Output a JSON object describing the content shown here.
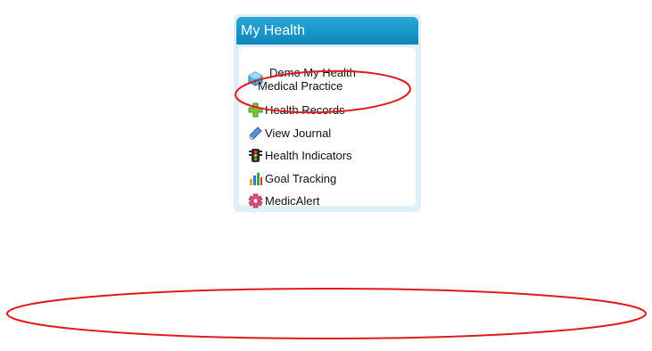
{
  "widget": {
    "title": "My Health",
    "items": [
      {
        "label_line1": "Demo My Health",
        "label_line2": "Medical Practice",
        "icon": "practice-icon"
      },
      {
        "label": "Health Records",
        "icon": "plus-cross-icon"
      },
      {
        "label": "View Journal",
        "icon": "pencil-icon"
      },
      {
        "label": "Health Indicators",
        "icon": "traffic-light-icon"
      },
      {
        "label": "Goal Tracking",
        "icon": "bar-chart-icon"
      },
      {
        "label": "MedicAlert",
        "icon": "medicalert-icon"
      }
    ]
  },
  "colors": {
    "header": "#1a97c9",
    "panel": "#dff0fb",
    "annotation": "#e0191b"
  }
}
